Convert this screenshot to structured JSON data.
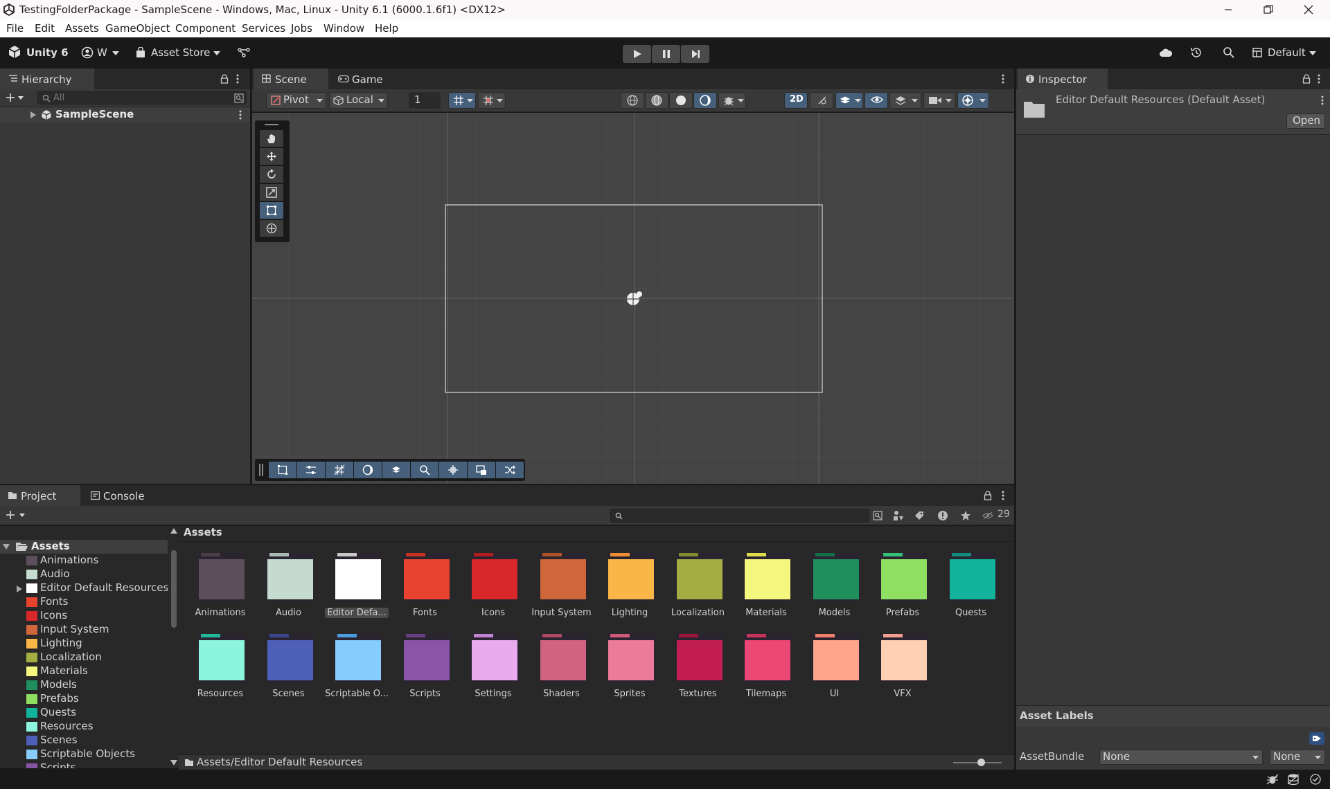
{
  "window": {
    "title": "TestingFolderPackage - SampleScene - Windows, Mac, Linux - Unity 6.1 (6000.1.6f1) <DX12>"
  },
  "menu": [
    "File",
    "Edit",
    "Assets",
    "GameObject",
    "Component",
    "Services",
    "Jobs",
    "Window",
    "Help"
  ],
  "toolbar": {
    "brand": "Unity 6",
    "account": "W",
    "asset_store": "Asset Store",
    "layout": "Default"
  },
  "hierarchy": {
    "tab": "Hierarchy",
    "search_placeholder": "All",
    "scene": "SampleScene"
  },
  "scene_view": {
    "tabs": [
      "Scene",
      "Game"
    ],
    "pivot": "Pivot",
    "local": "Local",
    "grid_value": "1",
    "mode_2d": "2D"
  },
  "inspector": {
    "tab": "Inspector",
    "title": "Editor Default Resources (Default Asset)",
    "open_button": "Open",
    "asset_labels": "Asset Labels",
    "assetbundle_label": "AssetBundle",
    "assetbundle_value": "None",
    "variant_value": "None"
  },
  "project": {
    "tabs": [
      "Project",
      "Console"
    ],
    "breadcrumb": "Assets",
    "hidden_count": "29",
    "path": "Assets/Editor Default Resources",
    "tree_root": "Assets",
    "tree": [
      {
        "name": "Animations",
        "color": "#5d4e5c"
      },
      {
        "name": "Audio",
        "color": "#c5dbd0"
      },
      {
        "name": "Editor Default Resources",
        "color": "#ffffff"
      },
      {
        "name": "Fonts",
        "color": "#e8432f"
      },
      {
        "name": "Icons",
        "color": "#d8282a"
      },
      {
        "name": "Input System",
        "color": "#d0673a"
      },
      {
        "name": "Lighting",
        "color": "#fbb648"
      },
      {
        "name": "Localization",
        "color": "#a3ad42"
      },
      {
        "name": "Materials",
        "color": "#f5f67e"
      },
      {
        "name": "Models",
        "color": "#1f8f5e"
      },
      {
        "name": "Prefabs",
        "color": "#8fdf63"
      },
      {
        "name": "Quests",
        "color": "#11b39a"
      },
      {
        "name": "Resources",
        "color": "#8df5de"
      },
      {
        "name": "Scenes",
        "color": "#4d5fb7"
      },
      {
        "name": "Scriptable Objects",
        "color": "#86ccfc"
      },
      {
        "name": "Scripts",
        "color": "#8a55a7"
      }
    ],
    "folders": [
      {
        "label": "Animations",
        "color": "#5d4e5c",
        "tab": "#4a3c49"
      },
      {
        "label": "Audio",
        "color": "#c5dbd0",
        "tab": "#a9b8b0"
      },
      {
        "label": "Editor Defa...",
        "color": "#ffffff",
        "tab": "#c8c8c8",
        "selected": true
      },
      {
        "label": "Fonts",
        "color": "#e8432f",
        "tab": "#c43022"
      },
      {
        "label": "Icons",
        "color": "#d8282a",
        "tab": "#b21d1f"
      },
      {
        "label": "Input System",
        "color": "#d0673a",
        "tab": "#ae512b"
      },
      {
        "label": "Lighting",
        "color": "#fbb648",
        "tab": "#ee8d33"
      },
      {
        "label": "Localization",
        "color": "#a3ad42",
        "tab": "#7f8a31"
      },
      {
        "label": "Materials",
        "color": "#f5f67e",
        "tab": "#dcdc4c"
      },
      {
        "label": "Models",
        "color": "#1f8f5e",
        "tab": "#166d47"
      },
      {
        "label": "Prefabs",
        "color": "#8fdf63",
        "tab": "#33c275"
      },
      {
        "label": "Quests",
        "color": "#11b39a",
        "tab": "#118e7b"
      },
      {
        "label": "Resources",
        "color": "#8df5de",
        "tab": "#23b79a"
      },
      {
        "label": "Scenes",
        "color": "#4d5fb7",
        "tab": "#3a478c"
      },
      {
        "label": "Scriptable O...",
        "color": "#86ccfc",
        "tab": "#4a9de0"
      },
      {
        "label": "Scripts",
        "color": "#8a55a7",
        "tab": "#6a3e83"
      },
      {
        "label": "Settings",
        "color": "#eaaaee",
        "tab": "#c183d3"
      },
      {
        "label": "Shaders",
        "color": "#d06282",
        "tab": "#ad4865"
      },
      {
        "label": "Sprites",
        "color": "#ec7b99",
        "tab": "#d05a7a"
      },
      {
        "label": "Textures",
        "color": "#c21e51",
        "tab": "#9c143e"
      },
      {
        "label": "Tilemaps",
        "color": "#ec4775",
        "tab": "#c8325c"
      },
      {
        "label": "UI",
        "color": "#ffa58c",
        "tab": "#f07f6b"
      },
      {
        "label": "VFX",
        "color": "#ffcfb4",
        "tab": "#f29f8d"
      }
    ]
  }
}
